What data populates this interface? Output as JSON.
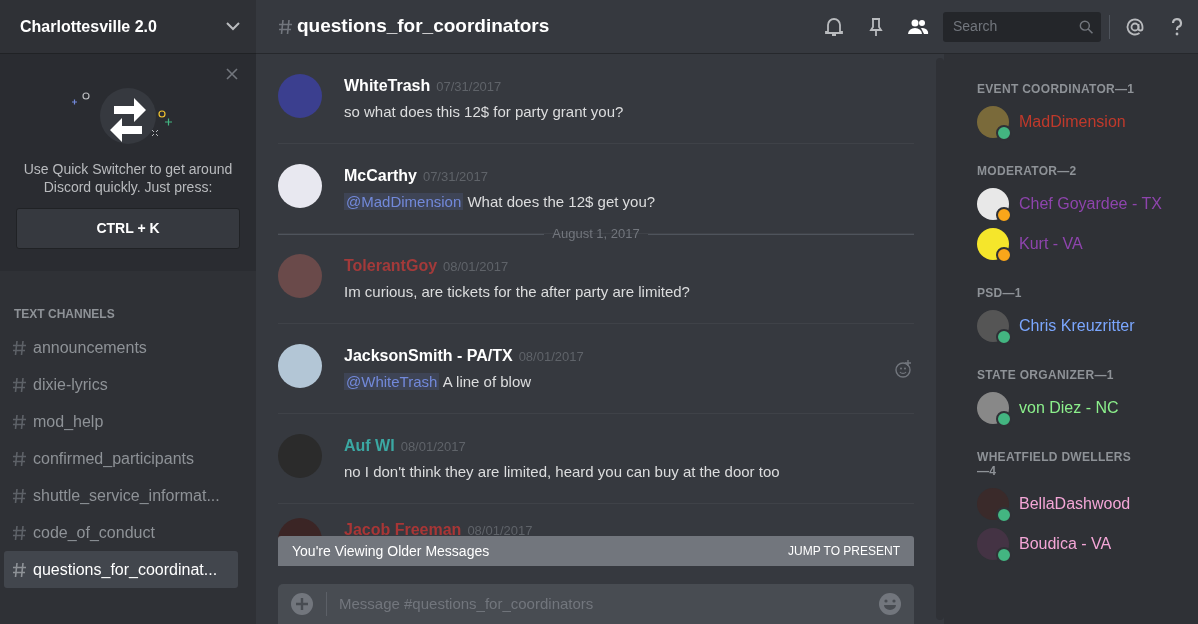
{
  "server": {
    "name": "Charlottesville 2.0"
  },
  "quick_switcher": {
    "text": "Use Quick Switcher to get around Discord quickly. Just press:",
    "shortcut": "CTRL + K"
  },
  "channel_category": "TEXT CHANNELS",
  "channels": [
    {
      "name": "announcements",
      "selected": false
    },
    {
      "name": "dixie-lyrics",
      "selected": false
    },
    {
      "name": "mod_help",
      "selected": false
    },
    {
      "name": "confirmed_participants",
      "selected": false
    },
    {
      "name": "shuttle_service_informat...",
      "selected": false
    },
    {
      "name": "code_of_conduct",
      "selected": false
    },
    {
      "name": "questions_for_coordinat...",
      "selected": true
    }
  ],
  "header": {
    "channel": "questions_for_coordinators",
    "search_placeholder": "Search"
  },
  "messages": [
    {
      "kind": "message",
      "author": "WhiteTrash",
      "color": "#ffffff",
      "time": "07/31/2017",
      "text": "so what does this 12$ for party grant you?"
    },
    {
      "kind": "message",
      "author": "McCarthy",
      "color": "#ffffff",
      "time": "07/31/2017",
      "mention": "@MadDimension",
      "text": "What does the 12$ get you?"
    },
    {
      "kind": "date",
      "label": "August 1, 2017"
    },
    {
      "kind": "message",
      "author": "TolerantGoy",
      "color": "#a33a3a",
      "time": "08/01/2017",
      "text": "Im curious, are tickets for the after party are limited?"
    },
    {
      "kind": "message",
      "author": "JacksonSmith - PA/TX",
      "color": "#ffffff",
      "time": "08/01/2017",
      "mention": "@WhiteTrash",
      "text": "A line of blow",
      "reaction_button": true
    },
    {
      "kind": "message",
      "author": "Auf WI",
      "color": "#3ba8a3",
      "time": "08/01/2017",
      "text": "no I don't think they are limited, heard you can buy at the door too"
    },
    {
      "kind": "message",
      "author": "Jacob Freeman",
      "color": "#a83636",
      "time": "08/01/2017"
    }
  ],
  "banner": {
    "text": "You're Viewing Older Messages",
    "action": "JUMP TO PRESENT"
  },
  "composer": {
    "placeholder": "Message #questions_for_coordinators"
  },
  "member_groups": [
    {
      "title": "EVENT COORDINATOR—1",
      "members": [
        {
          "name": "MadDimension",
          "color": "#c0392b",
          "status": {
            "color": "#43b581"
          }
        }
      ]
    },
    {
      "title": "MODERATOR—2",
      "members": [
        {
          "name": "Chef Goyardee - TX",
          "color": "#8e44ad",
          "status": {
            "color": "#faa61a"
          }
        },
        {
          "name": "Kurt - VA",
          "color": "#8e44ad",
          "status": {
            "color": "#faa61a"
          }
        }
      ]
    },
    {
      "title": "PSD—1",
      "members": [
        {
          "name": "Chris Kreuzritter",
          "color": "#7ba7ff",
          "status": {
            "color": "#43b581"
          }
        }
      ]
    },
    {
      "title": "STATE ORGANIZER—1",
      "members": [
        {
          "name": "von Diez - NC",
          "color": "#8cf08c",
          "status": {
            "color": "#43b581"
          }
        }
      ]
    },
    {
      "title": "WHEATFIELD DWELLERS—4",
      "members": [
        {
          "name": "BellaDashwood",
          "color": "#f4a6d7",
          "status": {
            "color": "#43b581"
          }
        },
        {
          "name": "Boudica - VA",
          "color": "#f4a6d7",
          "status": {
            "color": "#43b581"
          }
        }
      ]
    }
  ]
}
